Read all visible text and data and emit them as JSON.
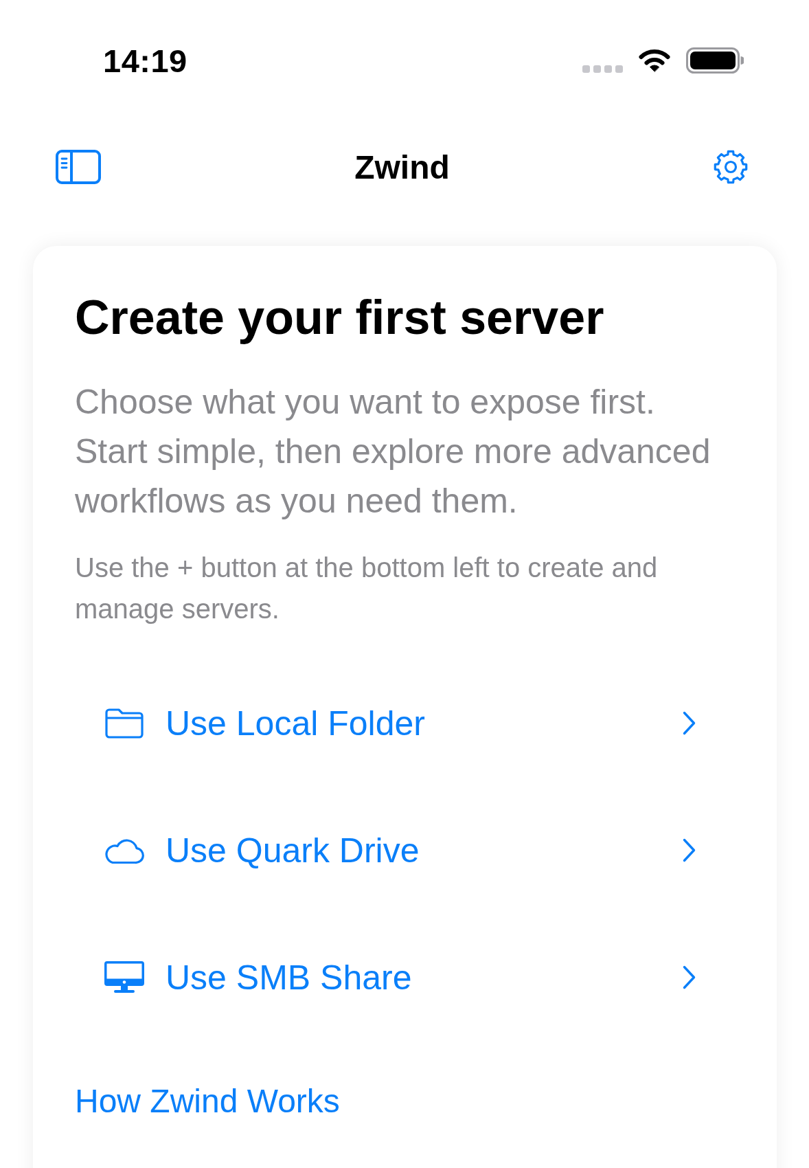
{
  "status_bar": {
    "time": "14:19"
  },
  "nav_bar": {
    "title": "Zwind"
  },
  "card": {
    "title": "Create your first server",
    "description": "Choose what you want to expose first. Start simple, then explore more advanced workflows as you need them.",
    "note": "Use the + button at the bottom left to create and manage servers.",
    "options": [
      {
        "kind": "folder",
        "label": "Use Local Folder"
      },
      {
        "kind": "cloud",
        "label": "Use Quark Drive"
      },
      {
        "kind": "monitor",
        "label": "Use SMB Share"
      }
    ],
    "link": "How Zwind Works"
  }
}
